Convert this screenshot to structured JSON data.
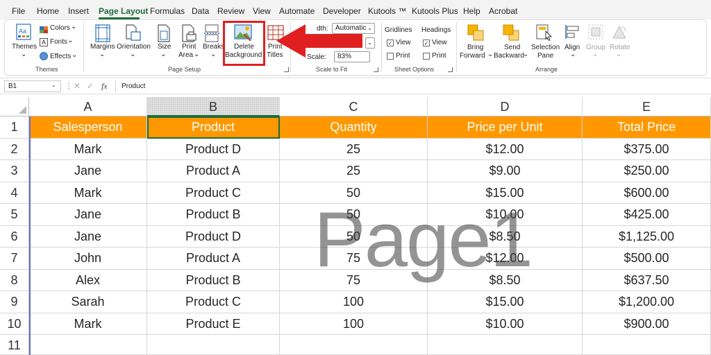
{
  "menu": {
    "items": [
      "File",
      "Home",
      "Insert",
      "Page Layout",
      "Formulas",
      "Data",
      "Review",
      "View",
      "Automate",
      "Developer",
      "Kutools ™",
      "Kutools Plus",
      "Help",
      "Acrobat"
    ],
    "active": "Page Layout"
  },
  "ribbon": {
    "themes": {
      "themes_label": "Themes",
      "colors_label": "Colors",
      "fonts_label": "Fonts",
      "effects_label": "Effects",
      "group_label": "Themes"
    },
    "page_setup": {
      "margins_label": "Margins",
      "orientation_label": "Orientation",
      "size_label": "Size",
      "print_area_line1": "Print",
      "print_area_line2": "Area",
      "breaks_label": "Breaks",
      "delete_bg_line1": "Delete",
      "delete_bg_line2": "Background",
      "print_titles_line1": "Print",
      "print_titles_line2": "Titles",
      "group_label": "Page Setup"
    },
    "scale_to_fit": {
      "width_label": "dth:",
      "width_value": "Automatic",
      "scale_label": "Scale:",
      "scale_value": "83%",
      "group_label": "Scale to Fit"
    },
    "sheet_options": {
      "gridlines_label": "Gridlines",
      "headings_label": "Headings",
      "gridlines_view_label": "View",
      "gridlines_print_label": "Print",
      "headings_view_label": "View",
      "headings_print_label": "Print",
      "group_label": "Sheet Options"
    },
    "arrange": {
      "bring_forward_line1": "Bring",
      "bring_forward_line2": "Forward",
      "send_backward_line1": "Send",
      "send_backward_line2": "Backward",
      "selection_pane_line1": "Selection",
      "selection_pane_line2": "Pane",
      "align_label": "Align",
      "group_btn_label": "Group",
      "rotate_label": "Rotate",
      "group_label": "Arrange"
    }
  },
  "formula_bar": {
    "name_box": "B1",
    "fx": "fx",
    "value": "Product"
  },
  "sheet": {
    "columns": [
      "A",
      "B",
      "C",
      "D",
      "E"
    ],
    "selected_column": "B",
    "row_numbers": [
      "1",
      "2",
      "3",
      "4",
      "5",
      "6",
      "7",
      "8",
      "9",
      "10",
      "11"
    ],
    "header": [
      "Salesperson",
      "Product",
      "Quantity",
      "Price per Unit",
      "Total Price"
    ],
    "rows": [
      [
        "Mark",
        "Product D",
        "25",
        "$12.00",
        "$375.00"
      ],
      [
        "Jane",
        "Product A",
        "25",
        "$9.00",
        "$250.00"
      ],
      [
        "Mark",
        "Product C",
        "50",
        "$15.00",
        "$600.00"
      ],
      [
        "Jane",
        "Product B",
        "50",
        "$10.00",
        "$425.00"
      ],
      [
        "Jane",
        "Product D",
        "50",
        "$8.50",
        "$1,125.00"
      ],
      [
        "John",
        "Product A",
        "75",
        "$12.00",
        "$500.00"
      ],
      [
        "Alex",
        "Product B",
        "75",
        "$8.50",
        "$637.50"
      ],
      [
        "Sarah",
        "Product C",
        "100",
        "$15.00",
        "$1,200.00"
      ],
      [
        "Mark",
        "Product E",
        "100",
        "$10.00",
        "$900.00"
      ]
    ],
    "watermark": "Page1",
    "header_fill": "#ff9800"
  },
  "colors": {
    "accent": "#1e6b3a",
    "highlight": "#e02020",
    "header_fill": "#ff9800"
  }
}
